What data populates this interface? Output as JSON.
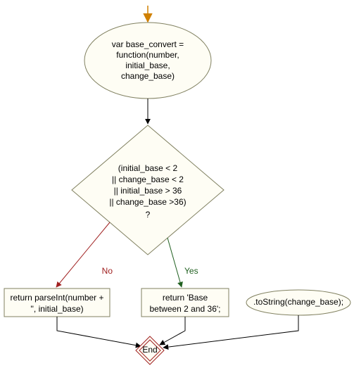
{
  "nodes": {
    "start": {
      "lines": [
        "var base_convert =",
        "function(number,",
        "initial_base,",
        "change_base)"
      ]
    },
    "decision": {
      "lines": [
        "(initial_base < 2",
        "|| change_base < 2",
        "|| initial_base > 36",
        "|| change_base >36)",
        "?"
      ]
    },
    "proc_no": {
      "lines": [
        "return parseInt(number +",
        "'', initial_base)"
      ]
    },
    "proc_yes": {
      "lines": [
        "return 'Base",
        "between 2 and 36';"
      ]
    },
    "proc_tostring": {
      "lines": [
        ".toString(change_base);"
      ]
    },
    "end": {
      "label": "End"
    }
  },
  "edges": {
    "no_label": "No",
    "yes_label": "Yes"
  }
}
